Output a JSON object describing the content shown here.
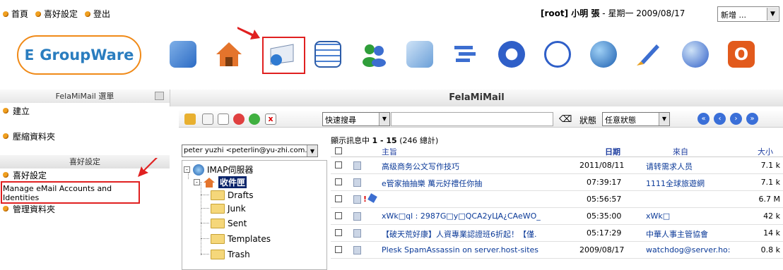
{
  "topnav": {
    "home": "首頁",
    "prefs": "喜好設定",
    "logout": "登出"
  },
  "userinfo": {
    "user": "[root] 小明 張",
    "date": "- 星期一 2009/08/17"
  },
  "new_select": {
    "value": "新增 ..."
  },
  "logo": {
    "text": "GroupWare"
  },
  "apps": [
    "admin-icon",
    "home-icon",
    "email-icon",
    "calendar-icon",
    "addressbook-icon",
    "infolog-icon",
    "projects-icon",
    "sitemgr-icon",
    "timesheet-icon",
    "network-icon",
    "notes-icon",
    "wiki-icon",
    "logout-icon"
  ],
  "sidebar": {
    "menu_title": "FelaMiMail 選單",
    "create": "建立",
    "compress": "壓縮資料夾",
    "prefs_title": "喜好設定",
    "prefs": "喜好設定",
    "manage_accounts": "Manage eMail Accounts and Identities",
    "manage_folders": "管理資料夾"
  },
  "main": {
    "title": "FelaMiMail",
    "quick_search": "快速搜尋",
    "status_label": "狀態",
    "status_value": "任意狀態",
    "count_prefix": "顯示訊息中",
    "count_range": "1 - 15",
    "count_total": "(246 總計)",
    "account": "peter yuzhi <peterlin@yu-zhi.com.tw>"
  },
  "tree": {
    "root": "IMAP伺服器",
    "inbox": "收件匣",
    "folders": [
      "Drafts",
      "Junk",
      "Sent",
      "Templates",
      "Trash"
    ]
  },
  "table": {
    "headers": {
      "subject": "主旨",
      "date": "日期",
      "from": "來自",
      "size": "大小"
    },
    "rows": [
      {
        "subject": "高级商务公文写作技巧",
        "date": "2011/08/11",
        "from": "请转需求人员",
        "size": "7.1 k"
      },
      {
        "subject": "e管家抽抽樂 萬元好禮任你抽",
        "date": "07:39:17",
        "from": "1111全球旅遊網",
        "size": "7.1 k"
      },
      {
        "subject": "",
        "date": "05:56:57",
        "from": "",
        "size": "6.7 M"
      },
      {
        "subject": "xWk□ql : 2987G□y□QCA2yЦA¿CAeWO_",
        "date": "05:35:00",
        "from": "xWk□",
        "size": "42 k"
      },
      {
        "subject": "【破天荒好康】人資專業認證班6折起！【僅.",
        "date": "05:17:29",
        "from": "中華人事主管協會",
        "size": "14 k"
      },
      {
        "subject": "Plesk SpamAssassin on server.host-sites",
        "date": "2009/08/17",
        "from": "watchdog@server.ho:",
        "size": "0.8 k"
      }
    ]
  }
}
